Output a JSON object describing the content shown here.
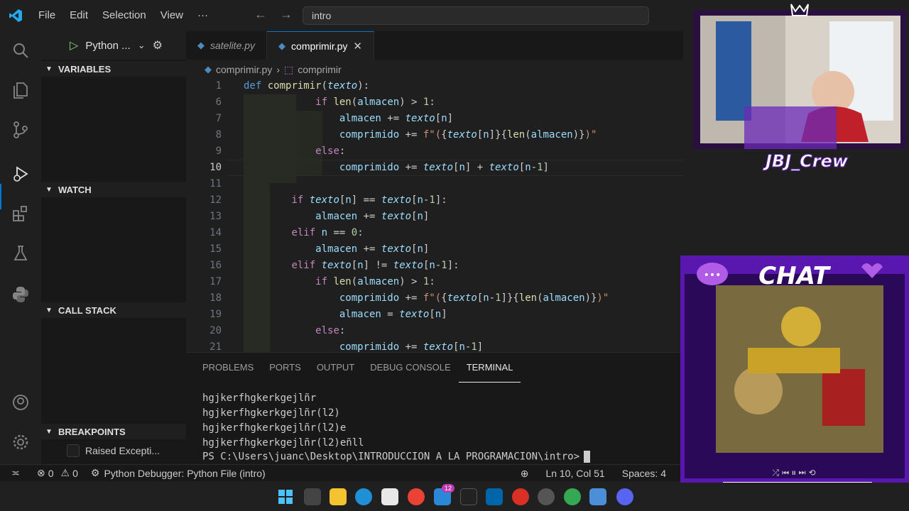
{
  "titlebar": {
    "menu": [
      "File",
      "Edit",
      "Selection",
      "View",
      "···"
    ],
    "search_text": "intro"
  },
  "sidebar": {
    "run_config": "Python ...",
    "sections": {
      "variables": "VARIABLES",
      "watch": "WATCH",
      "call_stack": "CALL STACK",
      "breakpoints": "BREAKPOINTS"
    },
    "breakpoint_item": "Raised Excepti..."
  },
  "tabs": [
    {
      "label": "satelite.py",
      "active": false
    },
    {
      "label": "comprimir.py",
      "active": true
    }
  ],
  "breadcrumb": {
    "file": "comprimir.py",
    "symbol": "comprimir"
  },
  "editor": {
    "current_line": "10",
    "line_numbers": [
      "1",
      "6",
      "7",
      "8",
      "9",
      "10",
      "11",
      "12",
      "13",
      "14",
      "15",
      "16",
      "17",
      "18",
      "19",
      "20",
      "21"
    ]
  },
  "panel": {
    "tabs": [
      "PROBLEMS",
      "PORTS",
      "OUTPUT",
      "DEBUG CONSOLE",
      "TERMINAL"
    ],
    "active_tab": "TERMINAL",
    "terminal_lines": [
      "hgjkerfhgkerkgejlñr",
      "hgjkerfhgkerkgejlñr(l2)",
      "hgjkerfhgkerkgejlñr(l2)e",
      "hgjkerfhgkerkgejlñr(l2)eñll",
      "PS C:\\Users\\juanc\\Desktop\\INTRODUCCION A LA PROGRAMACION\\intro>"
    ]
  },
  "statusbar": {
    "errors": "0",
    "warnings": "0",
    "debugger": "Python Debugger: Python File (intro)",
    "position": "Ln 10, Col 51",
    "spaces": "Spaces: 4"
  },
  "overlays": {
    "webcam_brand": "JBJ_Crew",
    "chat_title": "CHAT"
  },
  "taskbar": {
    "teams_badge": "12"
  },
  "colors": {
    "accent": "#0078d4",
    "overlay_purple": "#7a1fd1"
  }
}
